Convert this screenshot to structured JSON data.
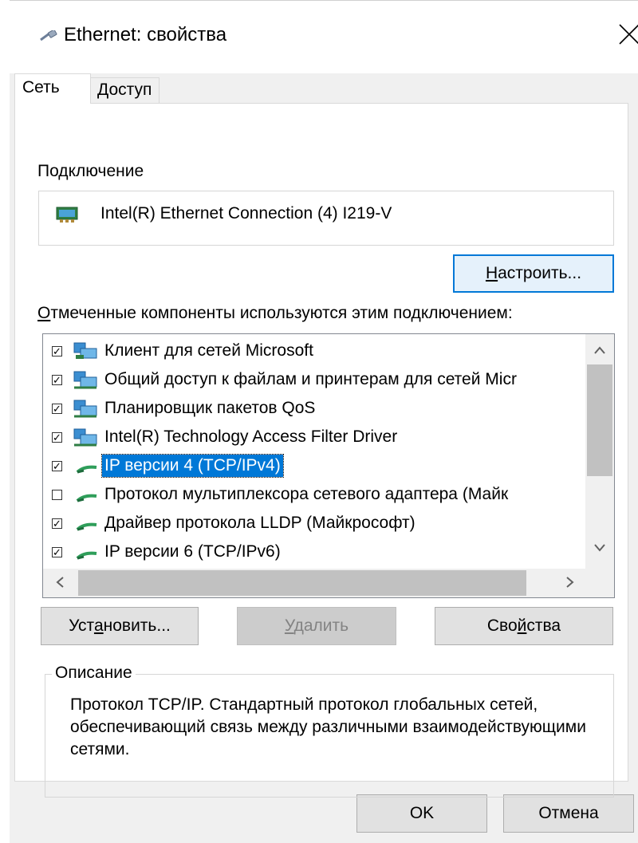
{
  "window": {
    "title": "Ethernet: свойства",
    "close_label": "×"
  },
  "tabs": [
    {
      "label": "Сеть",
      "active": true
    },
    {
      "label": "Доступ",
      "active": false
    }
  ],
  "connection": {
    "label": "Подключение",
    "adapter": "Intel(R) Ethernet Connection (4) I219-V",
    "configure_button": {
      "prefix": "",
      "accel": "Н",
      "rest": "астроить..."
    }
  },
  "components": {
    "label_accel": "О",
    "label_rest": "тмеченные компоненты используются этим подключением:",
    "items": [
      {
        "label": "Клиент для сетей Microsoft",
        "checked": true,
        "icon": "network-client-icon"
      },
      {
        "label": "Общий доступ к файлам и принтерам для сетей Micr",
        "checked": true,
        "icon": "network-service-icon"
      },
      {
        "label": "Планировщик пакетов QoS",
        "checked": true,
        "icon": "network-service-icon"
      },
      {
        "label": "Intel(R) Technology Access Filter Driver",
        "checked": true,
        "icon": "network-service-icon"
      },
      {
        "label": "IP версии 4 (TCP/IPv4)",
        "checked": true,
        "icon": "protocol-icon",
        "selected": true
      },
      {
        "label": "Протокол мультиплексора сетевого адаптера (Майк",
        "checked": false,
        "icon": "protocol-icon"
      },
      {
        "label": "Драйвер протокола LLDP (Майкрософт)",
        "checked": true,
        "icon": "protocol-icon"
      },
      {
        "label": "IP версии 6 (TCP/IPv6)",
        "checked": true,
        "icon": "protocol-icon"
      }
    ]
  },
  "actions": {
    "install": {
      "prefix": "Уст",
      "accel": "а",
      "rest": "новить..."
    },
    "uninstall": {
      "prefix": "",
      "accel": "У",
      "rest": "далить"
    },
    "properties": {
      "prefix": "Сво",
      "accel": "й",
      "rest": "ства"
    }
  },
  "description": {
    "legend": "Описание",
    "text": "Протокол TCP/IP. Стандартный протокол глобальных сетей, обеспечивающий связь между различными взаимодействующими сетями."
  },
  "dialog": {
    "ok_label": "OK",
    "cancel_label": "Отмена"
  },
  "colors": {
    "accent": "#0078d7",
    "selection_bg": "#0078d7",
    "dialog_bg": "#f0f0f0"
  }
}
